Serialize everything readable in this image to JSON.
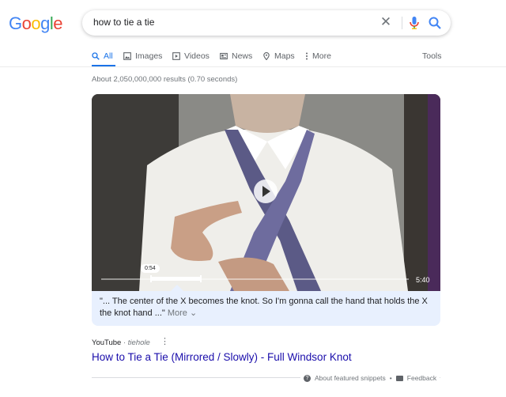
{
  "logo": {
    "letters": [
      "G",
      "o",
      "o",
      "g",
      "l",
      "e"
    ],
    "colors": [
      "#4285F4",
      "#EA4335",
      "#FBBC05",
      "#4285F4",
      "#34A853",
      "#EA4335"
    ]
  },
  "search": {
    "query": "how to tie a tie",
    "clear_icon": "close-icon",
    "mic_icon": "mic-icon",
    "search_icon": "search-icon"
  },
  "tabs": [
    {
      "label": "All",
      "icon": "search-icon",
      "active": true
    },
    {
      "label": "Images",
      "icon": "image-icon"
    },
    {
      "label": "Videos",
      "icon": "video-icon"
    },
    {
      "label": "News",
      "icon": "news-icon"
    },
    {
      "label": "Maps",
      "icon": "map-pin-icon"
    },
    {
      "label": "More",
      "icon": "more-vertical-icon"
    }
  ],
  "tools_label": "Tools",
  "result_stats": "About 2,050,000,000 results (0.70 seconds)",
  "video": {
    "current_time": "0:54",
    "duration": "5:40",
    "caption_text": "\"... The center of the X becomes the knot. So I'm gonna call the hand that holds the X the knot hand ...\"",
    "more_label": "More"
  },
  "result": {
    "site": "YouTube",
    "separator": "·",
    "author": "tiehole",
    "title": "How to Tie a Tie (Mirrored / Slowly) - Full Windsor Knot"
  },
  "footer": {
    "about_label": "About featured snippets",
    "dot": "•",
    "feedback_label": "Feedback"
  },
  "colors": {
    "accent": "#1a73e8",
    "link": "#1a0dab",
    "caption_bg": "#e8f0fe"
  }
}
